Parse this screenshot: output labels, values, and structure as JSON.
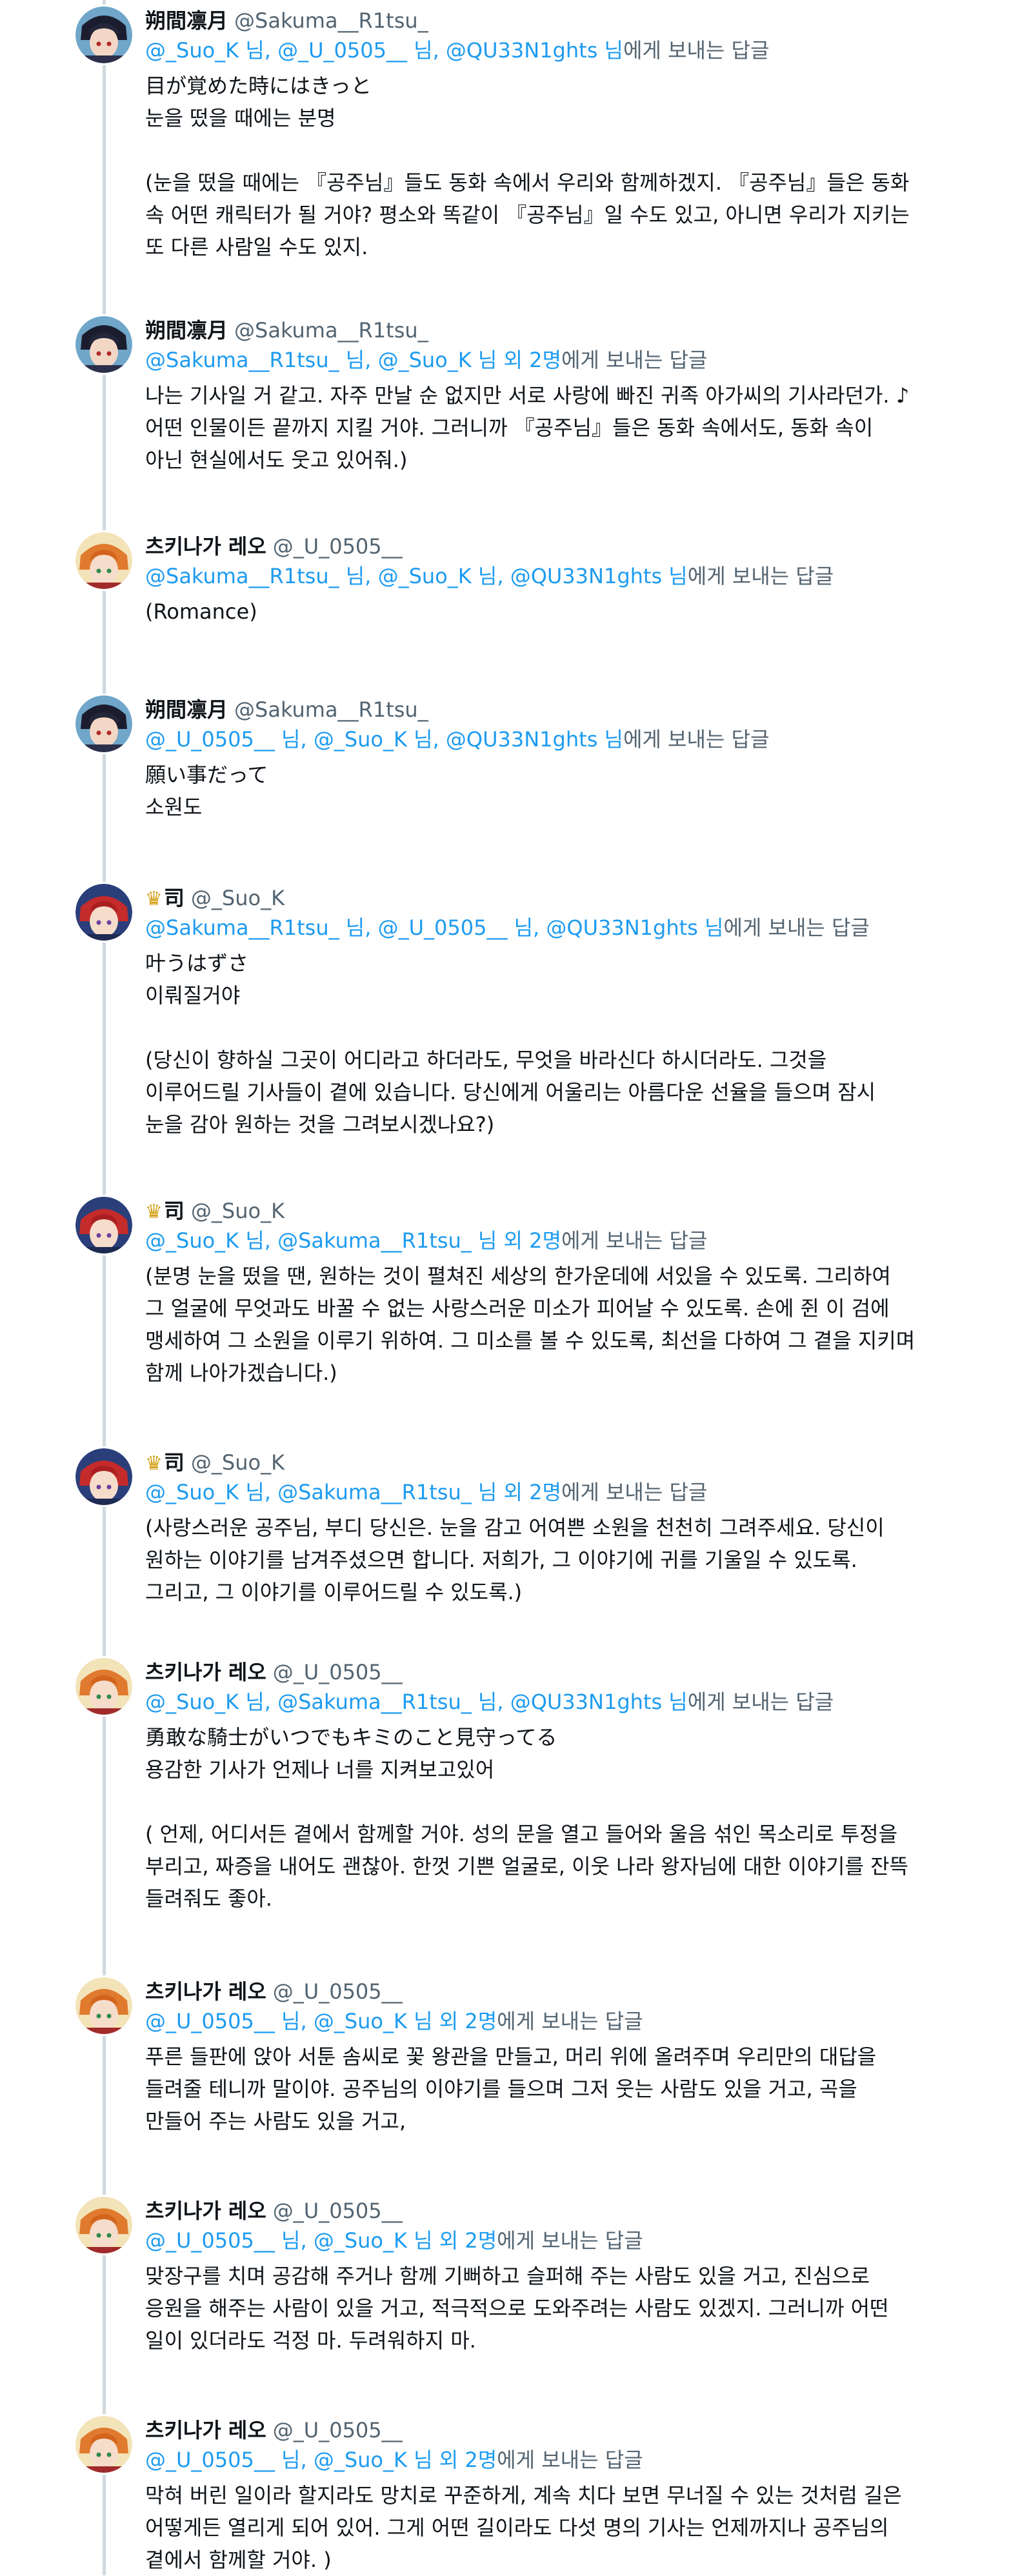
{
  "tweets": [
    {
      "name": "朔間凛月",
      "handle": "@Sakuma__R1tsu_",
      "crown": "",
      "avatar": "ritsu",
      "reply_mentions": "@_Suo_K 님, @_U_0505__ 님, @QU33N1ghts 님",
      "reply_suffix": "에게 보내는 답글",
      "lines": [
        "目が覚めた時にはきっと",
        "눈을 떴을 때에는 분명",
        "",
        "(눈을 떴을 때에는 『공주님』들도 동화 속에서 우리와 함께하겠지. 『공주님』들은 동화",
        "속 어떤 캐릭터가 될 거야? 평소와 똑같이 『공주님』일 수도 있고, 아니면 우리가 지키는",
        "또 다른 사람일 수도 있지."
      ]
    },
    {
      "name": "朔間凛月",
      "handle": "@Sakuma__R1tsu_",
      "crown": "",
      "avatar": "ritsu",
      "reply_mentions": "@Sakuma__R1tsu_ 님, @_Suo_K 님 외 2명",
      "reply_suffix": "에게 보내는 답글",
      "lines": [
        "나는 기사일 거 같고. 자주 만날 순 없지만 서로 사랑에 빠진 귀족 아가씨의 기사라던가. ♪",
        "어떤 인물이든 끝까지 지킬 거야. 그러니까 『공주님』들은 동화 속에서도, 동화 속이",
        "아닌 현실에서도 웃고 있어줘.)"
      ]
    },
    {
      "name": "츠키나가 레오",
      "handle": "@_U_0505__",
      "crown": "",
      "avatar": "leo",
      "reply_mentions": "@Sakuma__R1tsu_ 님, @_Suo_K 님, @QU33N1ghts 님",
      "reply_suffix": "에게 보내는 답글",
      "lines": [
        "(Romance)"
      ]
    },
    {
      "name": "朔間凛月",
      "handle": "@Sakuma__R1tsu_",
      "crown": "",
      "avatar": "ritsu",
      "reply_mentions": "@_U_0505__ 님, @_Suo_K 님, @QU33N1ghts 님",
      "reply_suffix": "에게 보내는 답글",
      "lines": [
        "願い事だって",
        "소원도"
      ]
    },
    {
      "name": "司",
      "handle": "@_Suo_K",
      "crown": "♛",
      "avatar": "tsukasa",
      "reply_mentions": "@Sakuma__R1tsu_ 님, @_U_0505__ 님, @QU33N1ghts 님",
      "reply_suffix": "에게 보내는 답글",
      "lines": [
        "叶うはずさ",
        "이뤄질거야",
        "",
        "(당신이 향하실 그곳이 어디라고 하더라도, 무엇을 바라신다 하시더라도. 그것을",
        "이루어드릴 기사들이 곁에 있습니다. 당신에게 어울리는 아름다운 선율을 들으며 잠시",
        "눈을 감아 원하는 것을 그려보시겠나요?)"
      ]
    },
    {
      "name": "司",
      "handle": "@_Suo_K",
      "crown": "♛",
      "avatar": "tsukasa",
      "reply_mentions": "@_Suo_K 님, @Sakuma__R1tsu_ 님 외 2명",
      "reply_suffix": "에게 보내는 답글",
      "lines": [
        "(분명 눈을 떴을 땐, 원하는 것이 펼쳐진 세상의 한가운데에 서있을 수 있도록. 그리하여",
        "그 얼굴에 무엇과도 바꿀 수 없는 사랑스러운 미소가 피어날 수 있도록. 손에 쥔 이 검에",
        "맹세하여 그 소원을 이루기 위하여. 그 미소를 볼 수 있도록, 최선을 다하여 그 곁을 지키며",
        "함께 나아가겠습니다.)"
      ]
    },
    {
      "name": "司",
      "handle": "@_Suo_K",
      "crown": "♛",
      "avatar": "tsukasa",
      "reply_mentions": "@_Suo_K 님, @Sakuma__R1tsu_ 님 외 2명",
      "reply_suffix": "에게 보내는 답글",
      "lines": [
        "(사랑스러운 공주님, 부디 당신은. 눈을 감고 어여쁜 소원을 천천히 그려주세요. 당신이",
        "원하는 이야기를 남겨주셨으면 합니다. 저희가, 그 이야기에 귀를 기울일 수 있도록.",
        "그리고, 그 이야기를 이루어드릴 수 있도록.)"
      ]
    },
    {
      "name": "츠키나가 레오",
      "handle": "@_U_0505__",
      "crown": "",
      "avatar": "leo",
      "reply_mentions": "@_Suo_K 님, @Sakuma__R1tsu_ 님, @QU33N1ghts 님",
      "reply_suffix": "에게 보내는 답글",
      "lines": [
        "勇敢な騎士がいつでもキミのこと見守ってる",
        "용감한 기사가 언제나 너를 지켜보고있어",
        "",
        "( 언제, 어디서든 곁에서 함께할 거야. 성의 문을 열고 들어와 울음 섞인 목소리로 투정을",
        "부리고, 짜증을 내어도 괜찮아. 한껏 기쁜 얼굴로, 이웃 나라 왕자님에 대한 이야기를 잔뜩",
        "들려줘도 좋아."
      ]
    },
    {
      "name": "츠키나가 레오",
      "handle": "@_U_0505__",
      "crown": "",
      "avatar": "leo",
      "reply_mentions": "@_U_0505__ 님, @_Suo_K 님 외 2명",
      "reply_suffix": "에게 보내는 답글",
      "lines": [
        "푸른 들판에 앉아 서툰 솜씨로 꽃 왕관을 만들고, 머리 위에 올려주며 우리만의 대답을",
        "들려줄 테니까 말이야. 공주님의 이야기를 들으며 그저 웃는 사람도 있을 거고, 곡을",
        "만들어 주는 사람도 있을 거고,"
      ]
    },
    {
      "name": "츠키나가 레오",
      "handle": "@_U_0505__",
      "crown": "",
      "avatar": "leo",
      "reply_mentions": "@_U_0505__ 님, @_Suo_K 님 외 2명",
      "reply_suffix": "에게 보내는 답글",
      "lines": [
        "맞장구를 치며 공감해 주거나 함께 기뻐하고 슬퍼해 주는 사람도 있을 거고, 진심으로",
        "응원을 해주는 사람이 있을 거고, 적극적으로 도와주려는 사람도 있겠지. 그러니까 어떤",
        "일이 있더라도 걱정 마. 두려워하지 마."
      ]
    },
    {
      "name": "츠키나가 레오",
      "handle": "@_U_0505__",
      "crown": "",
      "avatar": "leo",
      "reply_mentions": "@_U_0505__ 님, @_Suo_K 님 외 2명",
      "reply_suffix": "에게 보내는 답글",
      "lines": [
        "막혀 버린 일이라 할지라도 망치로 꾸준하게, 계속 치다 보면 무너질 수 있는 것처럼 길은",
        "어떻게든 열리게 되어 있어. 그게 어떤 길이라도 다섯 명의 기사는 언제까지나 공주님의",
        "곁에서 함께할 거야. )"
      ]
    }
  ]
}
